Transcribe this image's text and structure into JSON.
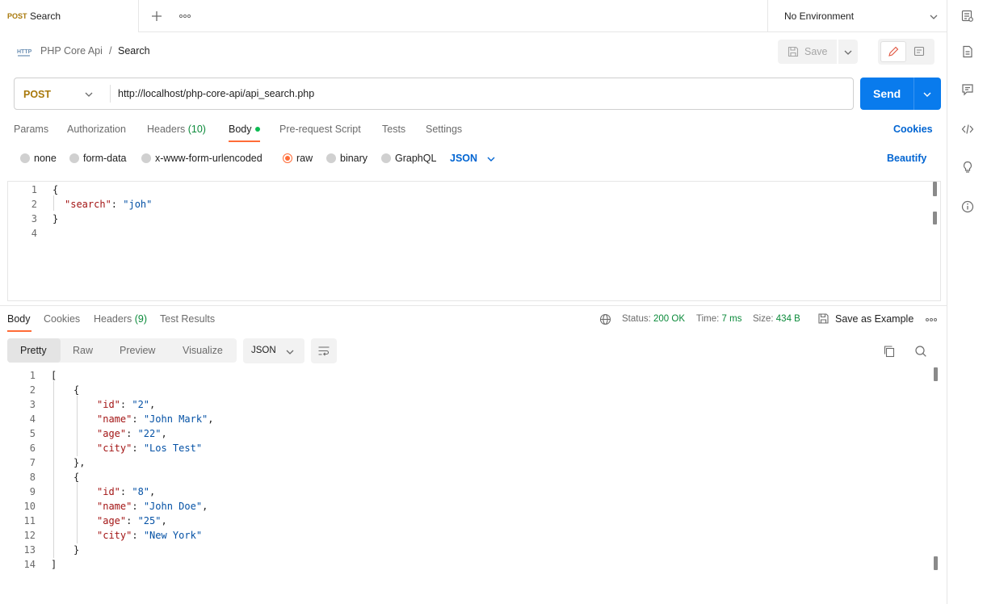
{
  "tab": {
    "method": "POST",
    "name": "Search"
  },
  "environment": {
    "label": "No Environment"
  },
  "breadcrumb": {
    "parent": "PHP Core Api",
    "separator": "/",
    "current": "Search"
  },
  "toolbar": {
    "save_label": "Save"
  },
  "request": {
    "method": "POST",
    "url": "http://localhost/php-core-api/api_search.php",
    "send_label": "Send"
  },
  "request_tabs": {
    "params": "Params",
    "authorization": "Authorization",
    "headers": "Headers",
    "headers_count": "(10)",
    "body": "Body",
    "prerequest": "Pre-request Script",
    "tests": "Tests",
    "settings": "Settings",
    "cookies": "Cookies"
  },
  "body_types": {
    "none": "none",
    "form_data": "form-data",
    "urlencoded": "x-www-form-urlencoded",
    "raw": "raw",
    "binary": "binary",
    "graphql": "GraphQL",
    "language": "JSON",
    "beautify": "Beautify",
    "selected": "raw"
  },
  "request_body": {
    "line_numbers": [
      "1",
      "2",
      "3",
      "4"
    ],
    "open": "{",
    "key": "\"search\"",
    "colon": ": ",
    "value": "\"joh\"",
    "close": "}"
  },
  "response_tabs": {
    "body": "Body",
    "cookies": "Cookies",
    "headers": "Headers",
    "headers_count": "(9)",
    "test_results": "Test Results"
  },
  "response_meta": {
    "status_label": "Status:",
    "status_value": "200 OK",
    "time_label": "Time:",
    "time_value": "7 ms",
    "size_label": "Size:",
    "size_value": "434 B",
    "save_example": "Save as Example"
  },
  "response_views": {
    "pretty": "Pretty",
    "raw": "Raw",
    "preview": "Preview",
    "visualize": "Visualize",
    "format": "JSON"
  },
  "response_body": {
    "line_numbers": [
      "1",
      "2",
      "3",
      "4",
      "5",
      "6",
      "7",
      "8",
      "9",
      "10",
      "11",
      "12",
      "13",
      "14"
    ],
    "records": [
      {
        "id": "\"2\"",
        "name": "\"John Mark\"",
        "age": "\"22\"",
        "city": "\"Los Test\""
      },
      {
        "id": "\"8\"",
        "name": "\"John Doe\"",
        "age": "\"25\"",
        "city": "\"New York\""
      }
    ],
    "keys": {
      "id": "\"id\"",
      "name": "\"name\"",
      "age": "\"age\"",
      "city": "\"city\""
    }
  },
  "colors": {
    "accent": "#ff6c37",
    "send": "#097bed",
    "method": "#a8780a",
    "success": "#0b8a3a",
    "link": "#0265d2"
  }
}
